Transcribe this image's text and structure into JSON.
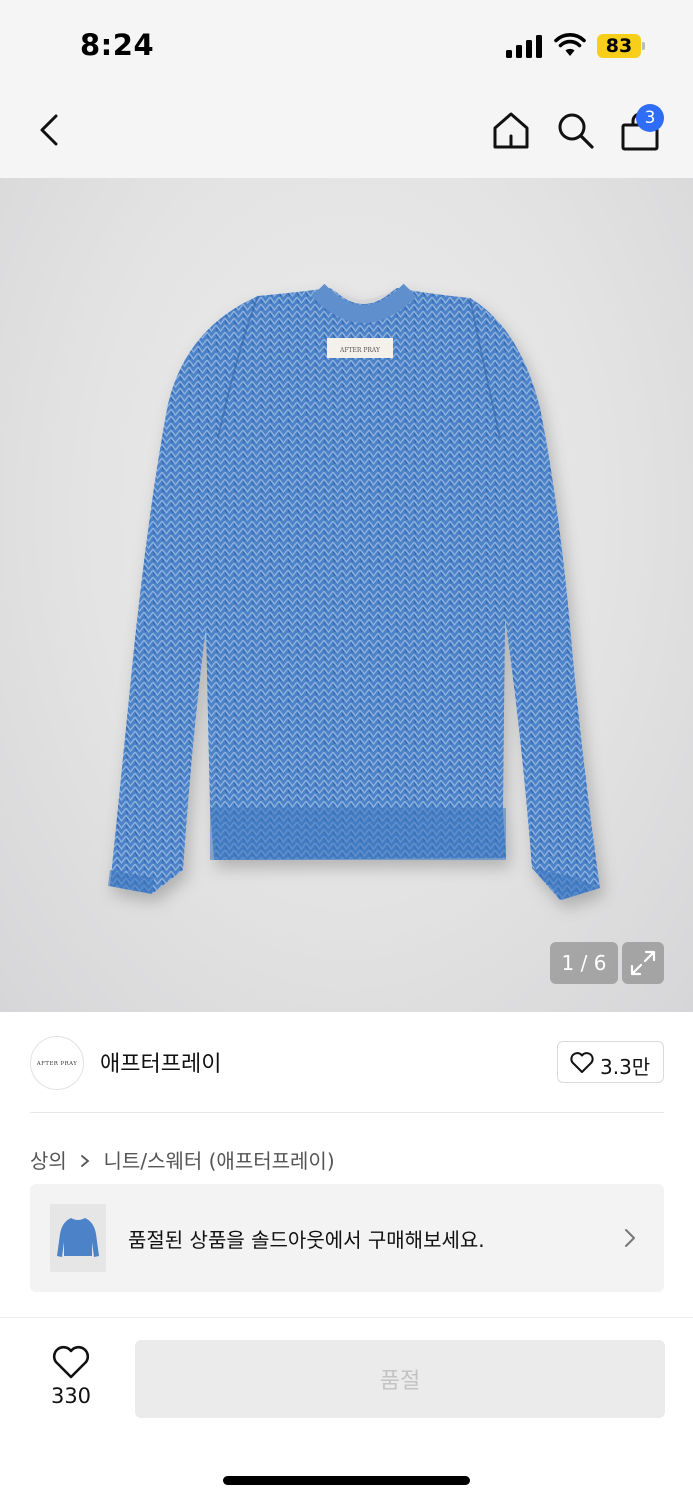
{
  "status_bar": {
    "time": "8:24",
    "battery": "83"
  },
  "header": {
    "back_icon": "chevron-left-icon",
    "home_icon": "home-icon",
    "search_icon": "search-icon",
    "cart_icon": "shopping-bag-icon",
    "cart_count": "3"
  },
  "gallery": {
    "counter": "1 / 6",
    "expand_icon": "expand-icon",
    "product_color": "#3f78c4"
  },
  "brand": {
    "logo_text": "AFTER PRAY",
    "name": "애프터프레이",
    "like_count": "3.3만"
  },
  "breadcrumb": {
    "category": "상의",
    "sub_category": "니트/스웨터 (애프터프레이)"
  },
  "soldout_banner": {
    "text": "품절된 상품을 솔드아웃에서 구매해보세요."
  },
  "bottom_bar": {
    "wish_count": "330",
    "button_label": "품절"
  },
  "colors": {
    "accent_blue": "#2f6df6",
    "battery_yellow": "#f7ce1a"
  }
}
